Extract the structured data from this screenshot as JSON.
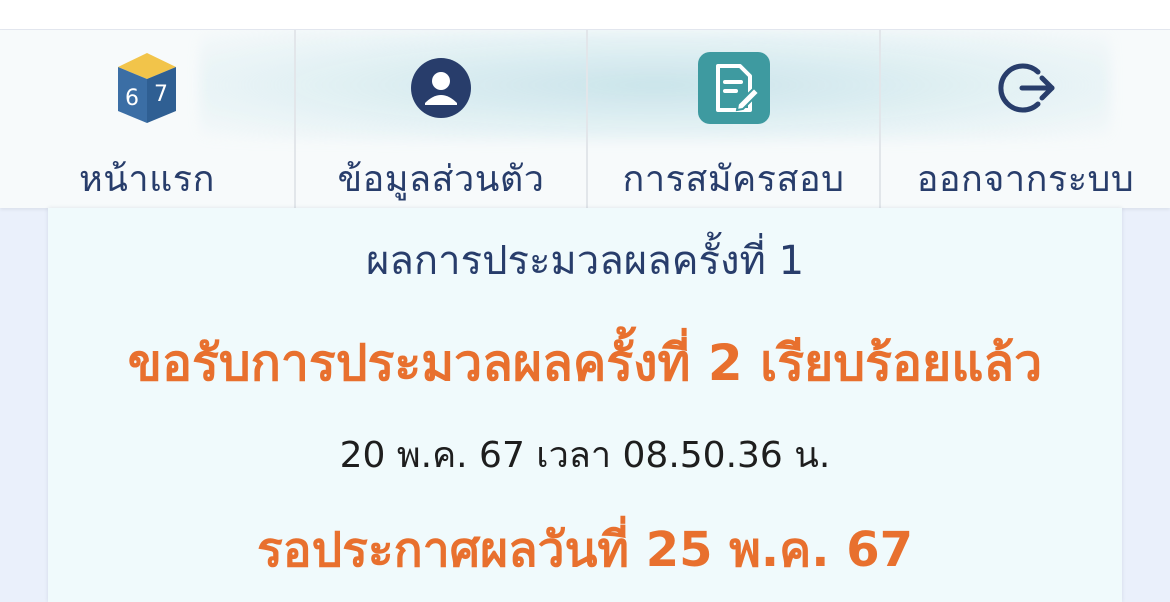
{
  "nav": {
    "items": [
      {
        "label": "หน้าแรก",
        "icon": "book-67-icon",
        "badge": {
          "left": "6",
          "right": "7"
        }
      },
      {
        "label": "ข้อมูลส่วนตัว",
        "icon": "user-profile-icon"
      },
      {
        "label": "การสมัครสอบ",
        "icon": "application-form-icon"
      },
      {
        "label": "ออกจากระบบ",
        "icon": "logout-icon"
      }
    ]
  },
  "result": {
    "heading": "ผลการประมวลผลครั้งที่ 1",
    "status": "ขอรับการประมวลผลครั้งที่ 2 เรียบร้อยแล้ว",
    "timestamp": "20 พ.ค. 67 เวลา 08.50.36 น.",
    "announcement": "รอประกาศผลวันที่ 25 พ.ค. 67"
  },
  "colors": {
    "navy": "#283d6b",
    "orange": "#e8702e",
    "teal": "#3e9aa0",
    "book_blue": "#3b6ea5",
    "book_yellow": "#f2c44a"
  }
}
